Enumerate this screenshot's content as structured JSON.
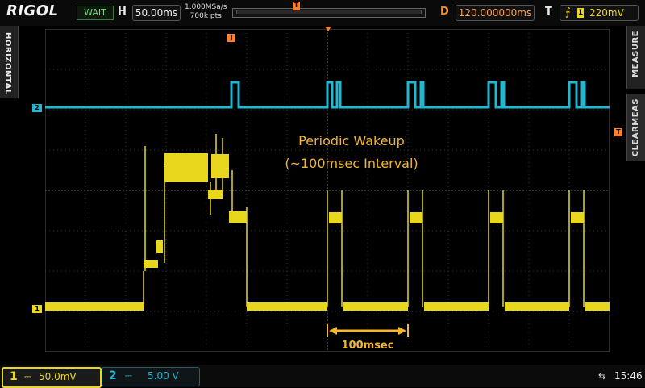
{
  "header": {
    "logo": "RIGOL",
    "run_state": "WAIT",
    "horizontal_label": "H",
    "timebase": "50.00ms",
    "sample_rate": "1.000MSa/s",
    "memory_depth": "700k pts",
    "trigger_position_marker": "T",
    "delay_label": "D",
    "delay_value": "120.000000ms",
    "trigger_label": "T",
    "trigger_source": "1",
    "trigger_level": "220mV"
  },
  "side_menu": {
    "horizontal": "HORIZONTAL",
    "measure": "MEASURE",
    "clear_meas": "CLEARMEAS"
  },
  "channels": {
    "ch1": {
      "number": "1",
      "coupling_symbol": "⎓",
      "scale": "50.0mV",
      "color": "#e8d71c"
    },
    "ch2": {
      "number": "2",
      "coupling_symbol": "⎓",
      "scale": "5.00 V",
      "color": "#22b8d2"
    }
  },
  "waveform_markers": {
    "trigger_in_screen": "T",
    "trigger_level_marker": "T"
  },
  "annotations": {
    "title_line1": "Periodic Wakeup",
    "title_line2": "(~100msec Interval)",
    "interval_label": "100msec",
    "annotation_color": "#f2b72c"
  },
  "status_bar": {
    "usb_icon": "usb-icon",
    "time": "15:46"
  }
}
